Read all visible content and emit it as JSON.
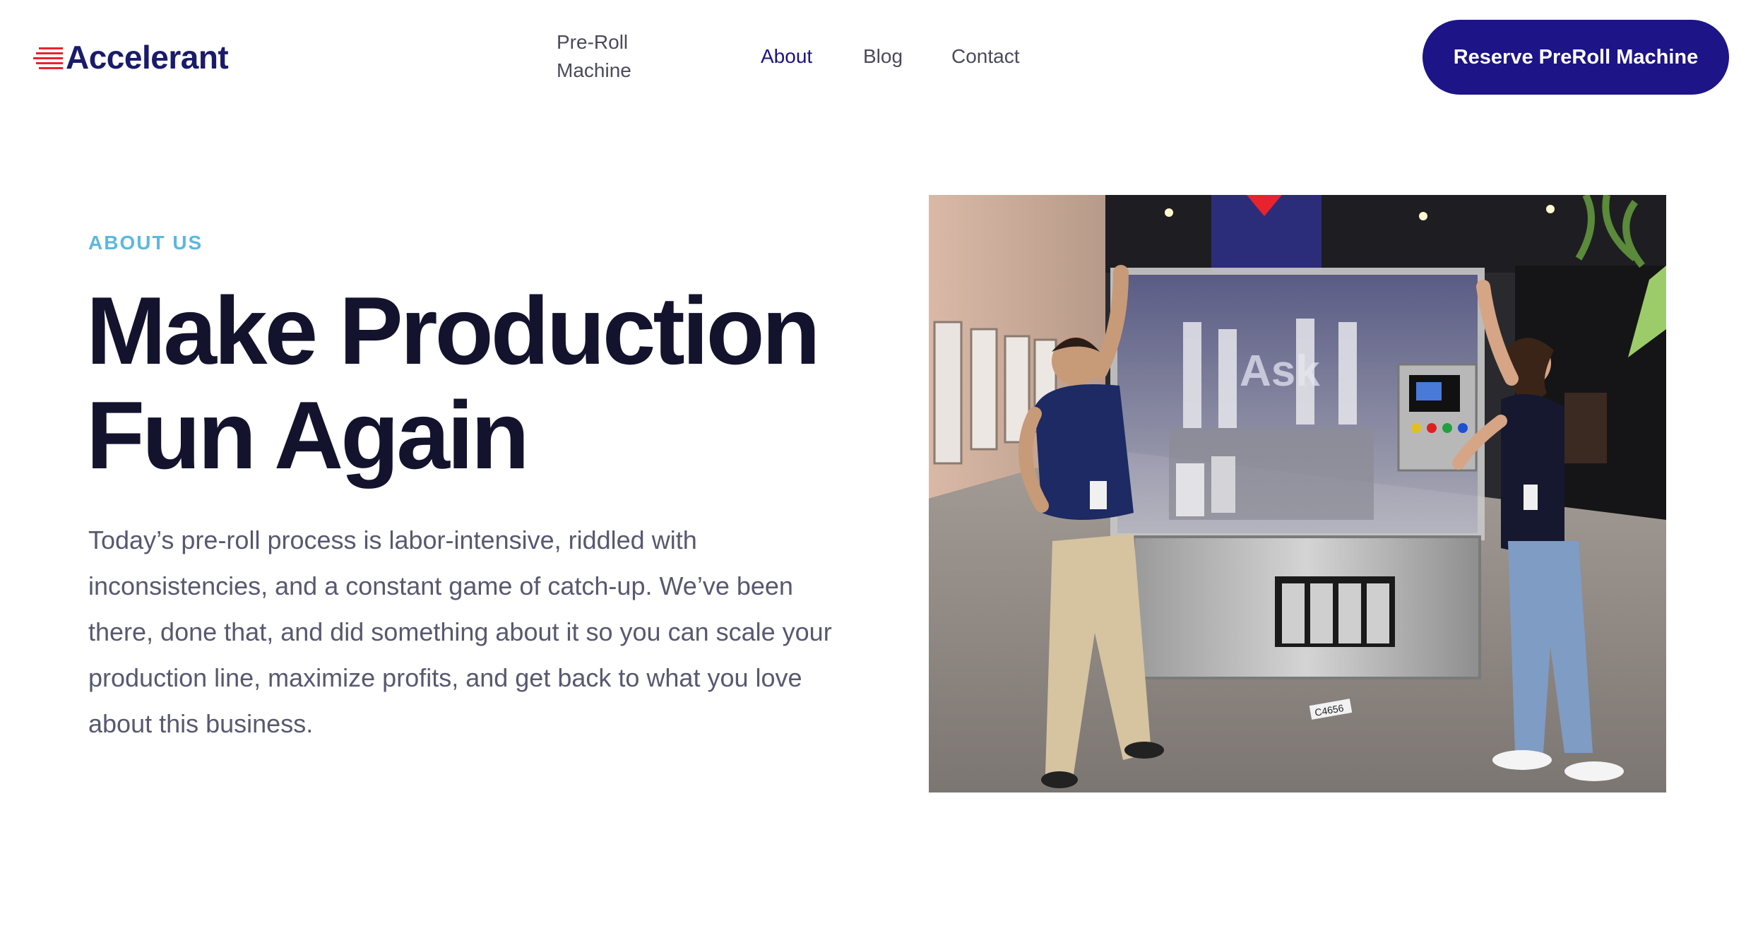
{
  "header": {
    "logo_text": "Accelerant",
    "nav": {
      "preroll_line1": "Pre-Roll",
      "preroll_line2": "Machine",
      "about": "About",
      "blog": "Blog",
      "contact": "Contact"
    },
    "cta_label": "Reserve PreRoll Machine",
    "colors": {
      "brand": "#1a1b6b",
      "cta": "#1c1487",
      "active_nav": "#1a1580"
    }
  },
  "hero": {
    "eyebrow": "ABOUT US",
    "headline_line1": "Make Production",
    "headline_line2": "Fun Again",
    "body": "Today’s pre-roll process is labor-intensive, riddled with inconsistencies, and a constant game of catch-up. We’ve been there, done that, and did something about it so you can scale your production line, maximize profits, and get back to what you love about this business.",
    "photo": {
      "sign_text": "Ask",
      "floor_tag": "C4656"
    },
    "colors": {
      "eyebrow": "#5bb8e0",
      "headline": "#13132e",
      "body": "#585870"
    }
  }
}
